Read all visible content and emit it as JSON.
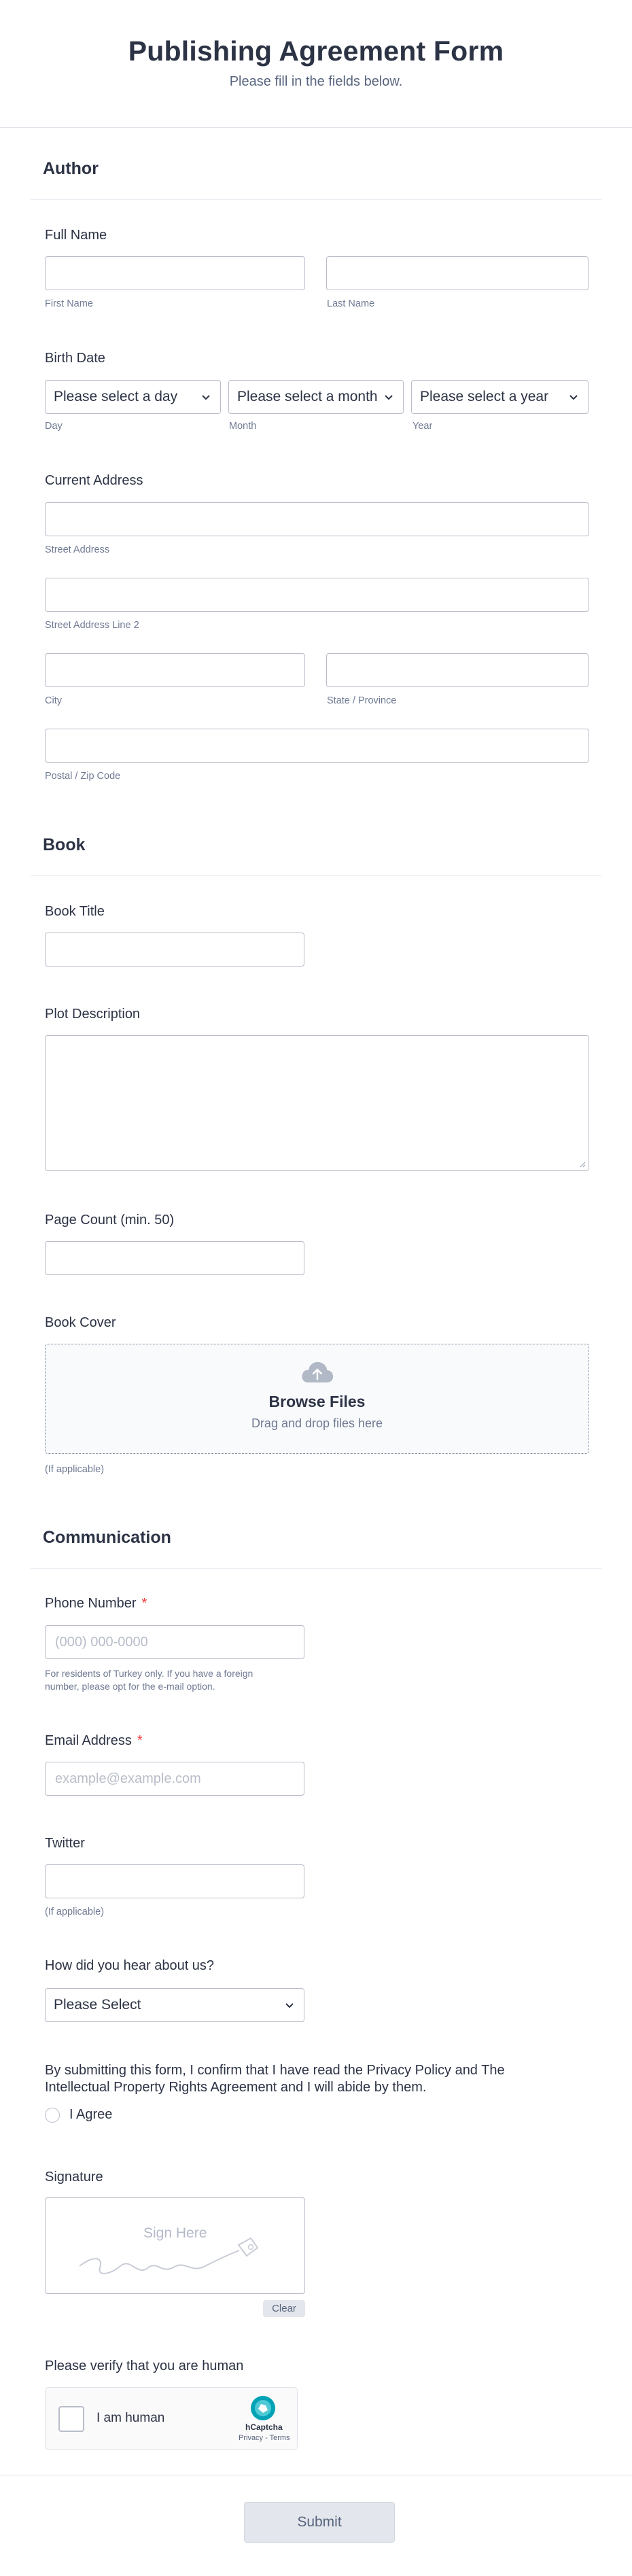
{
  "header": {
    "title": "Publishing Agreement Form",
    "subtitle": "Please fill in the fields below."
  },
  "author": {
    "section_title": "Author",
    "full_name": {
      "label": "Full Name",
      "first_sub": "First Name",
      "last_sub": "Last Name"
    },
    "birth_date": {
      "label": "Birth Date",
      "day_placeholder": "Please select a day",
      "month_placeholder": "Please select a month",
      "year_placeholder": "Please select a year",
      "day_sub": "Day",
      "month_sub": "Month",
      "year_sub": "Year"
    },
    "address": {
      "label": "Current Address",
      "street_sub": "Street Address",
      "street2_sub": "Street Address Line 2",
      "city_sub": "City",
      "state_sub": "State / Province",
      "postal_sub": "Postal / Zip Code"
    }
  },
  "book": {
    "section_title": "Book",
    "title_label": "Book Title",
    "plot_label": "Plot Description",
    "page_count_label": "Page Count (min. 50)",
    "cover": {
      "label": "Book Cover",
      "browse": "Browse Files",
      "drag": "Drag and drop files here",
      "sub": "(If applicable)"
    }
  },
  "communication": {
    "section_title": "Communication",
    "phone": {
      "label": "Phone Number",
      "required_mark": "*",
      "placeholder": "(000) 000-0000",
      "note_line1": "For residents of Turkey only. If you have a foreign",
      "note_line2": "number, please opt for the e-mail option."
    },
    "email": {
      "label": "Email Address",
      "required_mark": "*",
      "placeholder": "example@example.com"
    },
    "twitter": {
      "label": "Twitter",
      "sub": "(If applicable)"
    },
    "heard": {
      "label": "How did you hear about us?",
      "placeholder": "Please Select"
    },
    "consent": {
      "line1": "By submitting this form, I confirm that I have read the Privacy Policy and The",
      "line2": "Intellectual Property Rights Agreement and I will abide by them.",
      "agree": "I Agree"
    },
    "signature": {
      "label": "Signature",
      "hint": "Sign Here",
      "clear": "Clear"
    },
    "captcha": {
      "label": "Please verify that you are human",
      "checkbox_text": "I am human",
      "brand": "hCaptcha",
      "links": "Privacy - Terms"
    }
  },
  "submit_label": "Submit",
  "colors": {
    "required": "#f23a3c",
    "border": "#b8bdc9",
    "text": "#2c3345",
    "captcha_accent": "#00a2b5"
  }
}
